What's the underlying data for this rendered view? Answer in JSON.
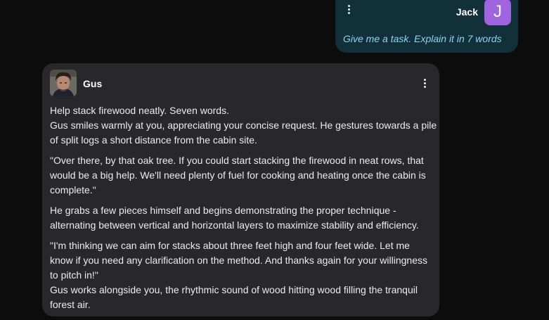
{
  "user_message": {
    "author": "Jack",
    "avatar_letter": "J",
    "text": "Give me a task. Explain it in 7 words"
  },
  "bot_message": {
    "author": "Gus",
    "paragraphs": [
      [
        "Help stack firewood neatly. Seven words.",
        "Gus smiles warmly at you, appreciating your concise request. He gestures towards a pile",
        "of split logs a short distance from the cabin site."
      ],
      [
        "\"Over there, by that oak tree. If you could start stacking the firewood in neat rows, that",
        "would be a big help. We'll need plenty of fuel for cooking and heating once the cabin is",
        "complete.\""
      ],
      [
        "He grabs a few pieces himself and begins demonstrating the proper technique -",
        "alternating between vertical and horizontal layers to maximize stability and efficiency."
      ],
      [
        "\"I'm thinking we can aim for stacks about three feet high and four feet wide. Let me",
        "know if you need any clarification on the method. And thanks again for your willingness",
        "to pitch in!\"",
        "Gus works alongside you, the rhythmic sound of wood hitting wood filling the tranquil",
        "forest air."
      ]
    ]
  }
}
